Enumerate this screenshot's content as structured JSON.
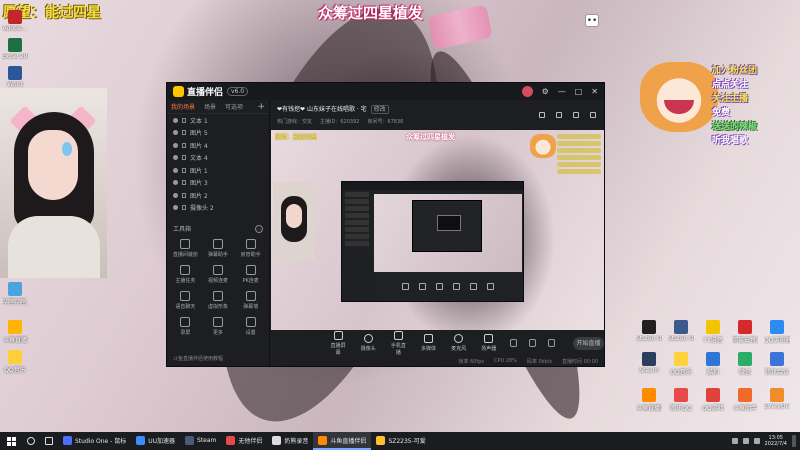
{
  "overlay": {
    "top_left": "愿望：能过四星",
    "top_center": "众筹过四星植发",
    "bubble": "••",
    "panel_items": [
      "加入粉丝团",
      "点点关注",
      "关注主播",
      "免费",
      "送送的辣椒",
      "听我唱歌"
    ]
  },
  "desktop_icons_left": [
    {
      "label": "Adobe..."
    },
    {
      "label": "Excel 2016"
    },
    {
      "label": "Word"
    },
    {
      "label": "哔哩哔哩..."
    },
    {
      "label": "斗鱼直播"
    },
    {
      "label": "QQ音乐"
    }
  ],
  "desktop_icons_right": [
    {
      "label": "Studio One"
    },
    {
      "label": "Studio One Pro"
    },
    {
      "label": "YY语音"
    },
    {
      "label": "网易云音乐"
    },
    {
      "label": "QQ浏览器"
    },
    {
      "label": "Steam"
    },
    {
      "label": "QQ音乐"
    },
    {
      "label": "酷狗"
    },
    {
      "label": "微信"
    },
    {
      "label": "腾讯会议"
    },
    {
      "label": "斗鱼直播伴侣"
    },
    {
      "label": "腾讯QQ"
    },
    {
      "label": "QQ游戏"
    },
    {
      "label": "斗鱼助手"
    },
    {
      "label": "Everything"
    }
  ],
  "app": {
    "name": "直播伴侣",
    "version": "v6.0",
    "titlebar_buttons": [
      "⚙",
      "—",
      "□",
      "✕"
    ],
    "tabs": [
      "我的场景",
      "场景",
      "可选项"
    ],
    "tab_add": "+",
    "sources": [
      "文本 1",
      "图片 5",
      "图片 4",
      "文本 4",
      "图片 1",
      "图片 3",
      "图片 2",
      "摄像头 2"
    ],
    "tools_title": "工具箱",
    "tools_more": "…",
    "tools": [
      "直播间装扮",
      "弹幕助手",
      "房管助手",
      "主播任务",
      "视频连麦",
      "PK连麦",
      "语音聊天",
      "虚拟形象",
      "弹幕墙",
      "录屏",
      "更多",
      "设置"
    ],
    "sidebar_footer": "斗鱼直播伴侣使用教程",
    "room": {
      "title": "❤有钱挖❤ 山东妹子在线唱歌 · 宅",
      "edit": "修改",
      "meta": [
        "热门游戏：交友",
        "主播ID：620392",
        "房间号：67838"
      ]
    },
    "preview": {
      "left": "愿望：能过四星",
      "center": "众筹过四星植发"
    },
    "controls": [
      "直播屏幕",
      "摄像头",
      "手机直播",
      "多媒体",
      "麦克风",
      "扬声器"
    ],
    "go_live": "开始直播",
    "status": [
      "帧率 60fps",
      "CPU 28%",
      "码率 0kb/s",
      "直播时间 00:00"
    ]
  },
  "taskbar": {
    "items": [
      {
        "label": "Studio One - 鼠标",
        "color": "#4d6fff"
      },
      {
        "label": "UU加速器",
        "color": "#3a8cff"
      },
      {
        "label": "Steam",
        "color": "#4a5b7a"
      },
      {
        "label": "无他伴侣",
        "color": "#e44a4a"
      },
      {
        "label": "奶熊录音",
        "color": "#dddddd"
      },
      {
        "label": "斗鱼直播伴侣",
        "color": "#ff8a00",
        "active": true
      },
      {
        "label": "SZ2235-可爱",
        "color": "#ffbe2e"
      }
    ],
    "time": "13:05",
    "date": "2022/7/4"
  }
}
